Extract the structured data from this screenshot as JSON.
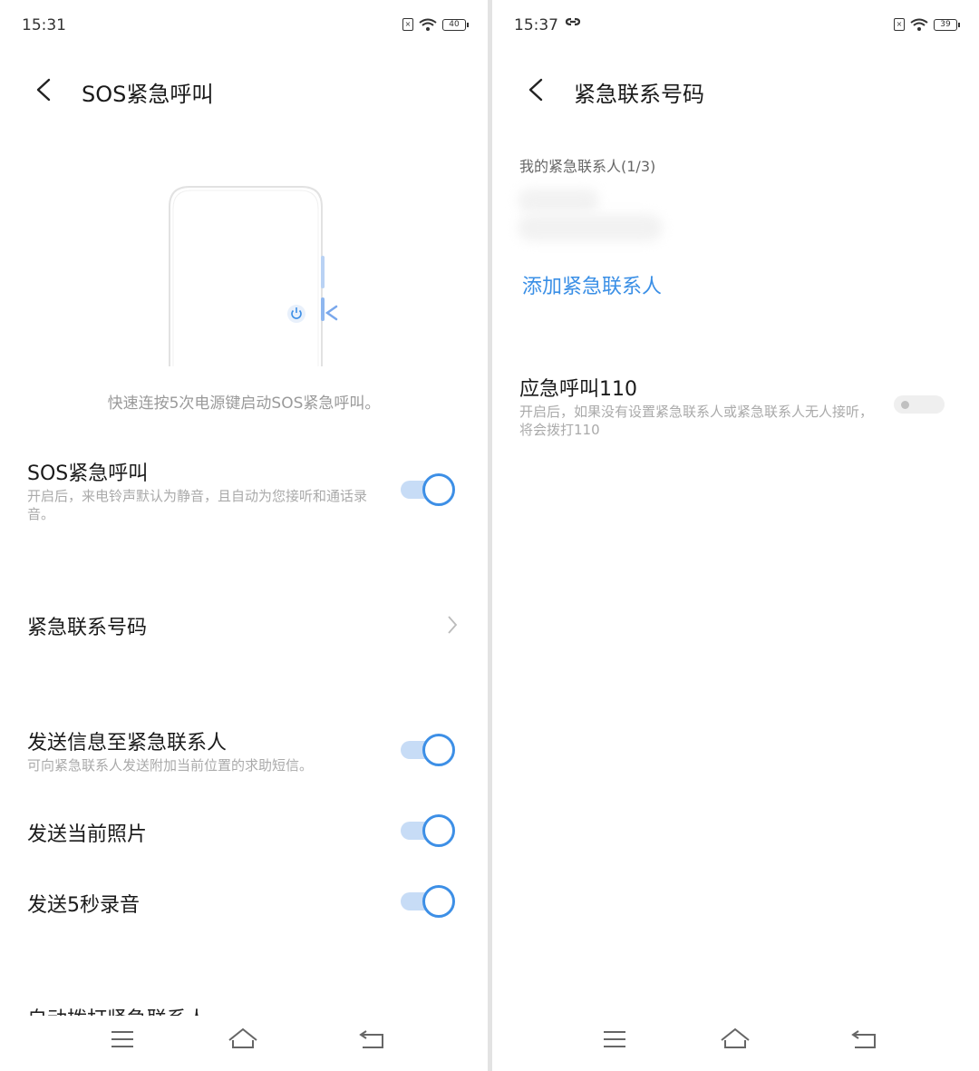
{
  "left": {
    "status": {
      "time": "15:31",
      "battery": "40"
    },
    "title": "SOS紧急呼叫",
    "caption": "快速连按5次电源键启动SOS紧急呼叫。",
    "sos": {
      "title": "SOS紧急呼叫",
      "sub": "开启后，来电铃声默认为静音，且自动为您接听和通话录音。",
      "on": true
    },
    "contacts_row": {
      "title": "紧急联系号码"
    },
    "send_msg": {
      "title": "发送信息至紧急联系人",
      "sub": "可向紧急联系人发送附加当前位置的求助短信。",
      "on": true
    },
    "send_photo": {
      "title": "发送当前照片",
      "on": true
    },
    "send_audio": {
      "title": "发送5秒录音",
      "on": true
    },
    "auto_dial": {
      "title": "自动拨打紧急联系人"
    }
  },
  "right": {
    "status": {
      "time": "15:37",
      "battery": "39"
    },
    "title": "紧急联系号码",
    "section_label": "我的紧急联系人(1/3)",
    "add_contact": "添加紧急联系人",
    "emergency": {
      "title": "应急呼叫110",
      "sub": "开启后，如果没有设置紧急联系人或紧急联系人无人接听，将会拨打110",
      "on": false
    }
  },
  "colors": {
    "accent": "#3d8fe6",
    "link": "#3a8fe6",
    "divider": "#e3e3e3"
  },
  "icons": [
    "back-arrow-icon",
    "power-icon",
    "chevron-right-icon",
    "menu-icon",
    "home-icon",
    "return-icon",
    "wifi-icon",
    "sim-icon",
    "battery-icon",
    "link-icon"
  ]
}
